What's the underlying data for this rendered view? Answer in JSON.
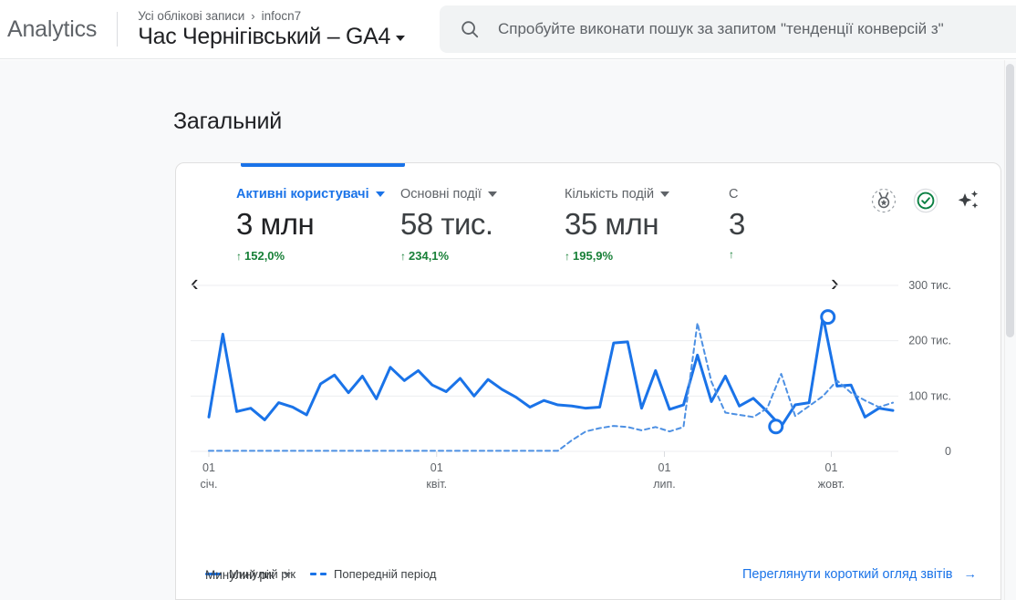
{
  "header": {
    "brand": "Analytics",
    "breadcrumb_account": "Усі облікові записи",
    "breadcrumb_separator": "›",
    "breadcrumb_property": "infocn7",
    "property_title": "Час Чернігівський – GA4",
    "search_placeholder": "Спробуйте виконати пошук за запитом \"тенденції конверсій з\""
  },
  "page": {
    "title": "Загальний"
  },
  "card": {
    "prev_arrow": "‹",
    "next_arrow": "›",
    "accent_color": "#1a73e8",
    "positive_color": "#188038",
    "icons": {
      "insights": "medal-insights-icon",
      "status": "check-circle-icon",
      "ai": "sparkle-icon"
    },
    "metrics": [
      {
        "label": "Активні користувачі",
        "value": "3 млн",
        "delta": "152,0%",
        "direction": "up",
        "active": true
      },
      {
        "label": "Основні події",
        "value": "58 тис.",
        "delta": "234,1%",
        "direction": "up",
        "active": false
      },
      {
        "label": "Кількість подій",
        "value": "35 млн",
        "delta": "195,9%",
        "direction": "up",
        "active": false
      },
      {
        "label": "С",
        "value": "3",
        "delta": "",
        "direction": "up",
        "active": false
      }
    ],
    "legend": [
      {
        "label": "Минулий рік",
        "style": "solid"
      },
      {
        "label": "Попередній період",
        "style": "dashed"
      }
    ],
    "footer": {
      "range_label": "Минулий рік",
      "link_label": "Переглянути короткий огляд звітів",
      "link_arrow": "→"
    }
  },
  "chart_data": {
    "type": "line",
    "title": "",
    "xlabel": "",
    "ylabel": "",
    "ylim": [
      0,
      300000
    ],
    "grid": true,
    "legend_position": "bottom-left",
    "y_ticks": [
      {
        "value": 0,
        "label": "0"
      },
      {
        "value": 100000,
        "label": "100 тис."
      },
      {
        "value": 200000,
        "label": "200 тис."
      },
      {
        "value": 300000,
        "label": "300 тис."
      }
    ],
    "x_ticks": [
      {
        "pos": 0.0,
        "day": "01",
        "month": "січ."
      },
      {
        "pos": 0.333,
        "day": "01",
        "month": "квіт."
      },
      {
        "pos": 0.666,
        "day": "01",
        "month": "лип."
      },
      {
        "pos": 0.91,
        "day": "01",
        "month": "жовт."
      }
    ],
    "markers": [
      {
        "series": "Минулий рік",
        "x": 0.905,
        "y": 243000,
        "kind": "peak"
      },
      {
        "series": "Минулий рік",
        "x": 0.829,
        "y": 45000,
        "kind": "low"
      }
    ],
    "series": [
      {
        "name": "Минулий рік",
        "style": "solid",
        "color": "#1a73e8",
        "values": [
          62000,
          212000,
          72000,
          78000,
          57000,
          88000,
          80000,
          66000,
          122000,
          138000,
          106000,
          136000,
          95000,
          152000,
          128000,
          146000,
          120000,
          108000,
          132000,
          100000,
          130000,
          112000,
          98000,
          80000,
          92000,
          84000,
          82000,
          78000,
          80000,
          196000,
          198000,
          78000,
          146000,
          76000,
          84000,
          174000,
          90000,
          136000,
          82000,
          96000,
          72000,
          45000,
          84000,
          88000,
          243000,
          118000,
          120000,
          62000,
          78000,
          74000
        ]
      },
      {
        "name": "Попередній період",
        "style": "dashed",
        "color": "#4d90e3",
        "values": [
          1000,
          1000,
          1000,
          1000,
          1000,
          1000,
          1000,
          1000,
          1000,
          1000,
          1000,
          1000,
          1000,
          1000,
          1000,
          1000,
          1000,
          1000,
          1000,
          1000,
          1000,
          1000,
          1000,
          1000,
          1000,
          1000,
          20000,
          36000,
          42000,
          46000,
          44000,
          38000,
          44000,
          36000,
          44000,
          232000,
          126000,
          70000,
          66000,
          62000,
          78000,
          140000,
          64000,
          82000,
          100000,
          128000,
          106000,
          92000,
          80000,
          88000
        ]
      }
    ]
  }
}
